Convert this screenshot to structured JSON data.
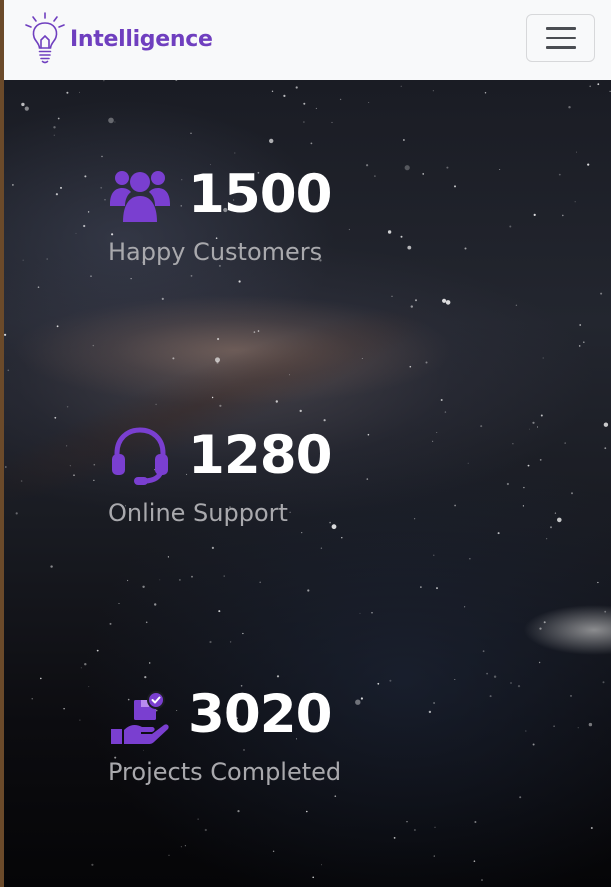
{
  "navbar": {
    "brand_icon": "lightbulb-icon",
    "brand_text": "Intelligence",
    "toggler_icon": "hamburger-menu-icon"
  },
  "stats": [
    {
      "icon": "users-icon",
      "value": "1500",
      "label": "Happy Customers"
    },
    {
      "icon": "headset-icon",
      "value": "1280",
      "label": "Online Support"
    },
    {
      "icon": "hand-holding-box-icon",
      "value": "3020",
      "label": "Projects Completed"
    }
  ],
  "colors": {
    "brand": "#6f3fbf",
    "icon_accent": "#7a3fd0",
    "number": "#ffffff",
    "label": "#a9a9ad",
    "navbar_bg": "#f8f9fa"
  }
}
